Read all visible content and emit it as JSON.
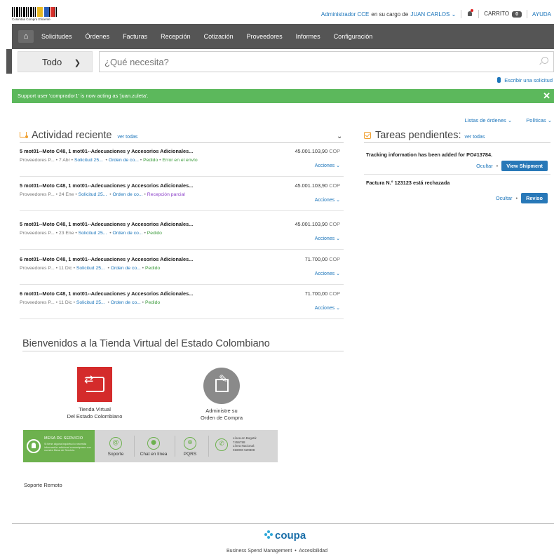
{
  "header": {
    "logo_caption": "Colombia Compra Eficiente",
    "admin_link": "Administrador CCE",
    "acting_text": "en su cargo de",
    "user_link": "JUAN CARLOS",
    "cart_label": "CARRITO",
    "cart_count": "0",
    "help_label": "AYUDA"
  },
  "nav": {
    "items": [
      "Solicitudes",
      "Órdenes",
      "Facturas",
      "Recepción",
      "Cotización",
      "Proveedores",
      "Informes",
      "Configuración"
    ]
  },
  "search": {
    "scope": "Todo",
    "placeholder": "¿Qué necesita?",
    "write_request": "Escribir una solicitud"
  },
  "banner": {
    "message": "Support user 'comprador1' is now acting as 'juan.zuleta'."
  },
  "quick_links": {
    "orders": "Listas de órdenes",
    "policies": "Políticas"
  },
  "activity": {
    "title": "Actividad reciente",
    "view_all": "ver todas",
    "rows": [
      {
        "title": "5 mot01--Moto C48, 1 mot01--Adecuaciones y Accesorios Adicionales...",
        "amount": "45.001.103,90",
        "currency": "COP",
        "supplier": "Proveedores P...",
        "date": "7 Abr",
        "req": "Solicitud 25...",
        "order": "Orden de co...",
        "status1": "Pedido",
        "status2": "Error en el envío",
        "actions": "Acciones"
      },
      {
        "title": "5 mot01--Moto C48, 1 mot01--Adecuaciones y Accesorios Adicionales...",
        "amount": "45.001.103,90",
        "currency": "COP",
        "supplier": "Proveedores P...",
        "date": "24 Ene",
        "req": "Solicitud 25...",
        "order": "Orden de co...",
        "status1": "Recepción parcial",
        "actions": "Acciones"
      },
      {
        "title": "5 mot01--Moto C48, 1 mot01--Adecuaciones y Accesorios Adicionales...",
        "amount": "45.001.103,90",
        "currency": "COP",
        "supplier": "Proveedores P...",
        "date": "23 Ene",
        "req": "Solicitud 25...",
        "order": "Orden de co...",
        "status1": "Pedido",
        "actions": "Acciones"
      },
      {
        "title": "6 mot01--Moto C48, 1 mot01--Adecuaciones y Accesorios Adicionales...",
        "amount": "71.700,00",
        "currency": "COP",
        "supplier": "Proveedores P...",
        "date": "11 Dic",
        "req": "Solicitud 25...",
        "order": "Orden de co...",
        "status1": "Pedido",
        "actions": "Acciones"
      },
      {
        "title": "6 mot01--Moto C48, 1 mot01--Adecuaciones y Accesorios Adicionales...",
        "amount": "71.700,00",
        "currency": "COP",
        "supplier": "Proveedores P...",
        "date": "11 Dic",
        "req": "Solicitud 25...",
        "order": "Orden de co...",
        "status1": "Pedido",
        "actions": "Acciones"
      }
    ]
  },
  "tasks": {
    "title": "Tareas pendientes:",
    "view_all": "ver todas",
    "items": [
      {
        "text": "Tracking information has been added for PO#13784.",
        "hide": "Ocultar",
        "action": "View Shipment"
      },
      {
        "text": "Factura N.° 123123 está rechazada",
        "hide": "Ocultar",
        "action": "Reviso"
      }
    ]
  },
  "welcome": {
    "title": "Bienvenidos a la Tienda Virtual del Estado Colombiano",
    "tile1_line1": "Tienda Virtual",
    "tile1_line2": "Del Estado Colombiano",
    "tile2_line1": "Administre su",
    "tile2_line2": "Orden de Compra"
  },
  "service": {
    "title": "MESA DE SERVICIO",
    "desc": "Si tiene alguna inquietud o necesita información adicional comuníquese con nuestra Mesa de Servicio.",
    "support": "Soporte",
    "chat": "Chat en línea",
    "pqrs": "PQRS",
    "line_bogota_label": "Línea en Bogotá:",
    "line_bogota": "7456788",
    "line_national_label": "Línea Nacional:",
    "line_national": "018000 520808"
  },
  "remote_support": "Soporte Remoto",
  "footer": {
    "brand": "coupa",
    "bsm": "Business Spend Management",
    "accessibility": "Accesibilidad"
  },
  "colors": {
    "nav_bg": "#555555",
    "banner_green": "#5cb85c",
    "link_blue": "#1a74ba",
    "button_blue": "#2878b8"
  }
}
